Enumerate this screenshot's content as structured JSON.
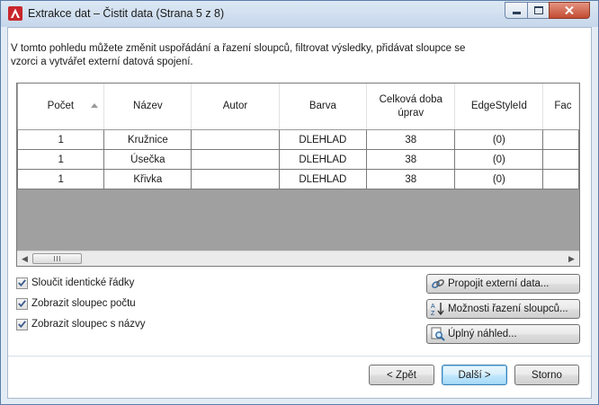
{
  "window": {
    "title": "Extrakce dat – Čistit data (Strana 5 z 8)"
  },
  "description": "V tomto pohledu můžete změnit uspořádání a řazení sloupců, filtrovat výsledky, přidávat sloupce se vzorci a vytvářet externí datová spojení.",
  "grid": {
    "columns": [
      "Počet",
      "Název",
      "Autor",
      "Barva",
      "Celková doba úprav",
      "EdgeStyleId",
      "Fac"
    ],
    "sorted_column": "Počet",
    "sort_direction": "ascending",
    "rows": [
      [
        "1",
        "Kružnice",
        "",
        "DLEHLAD",
        "38",
        "(0)",
        ""
      ],
      [
        "1",
        "Úsečka",
        "",
        "DLEHLAD",
        "38",
        "(0)",
        ""
      ],
      [
        "1",
        "Křivka",
        "",
        "DLEHLAD",
        "38",
        "(0)",
        ""
      ]
    ]
  },
  "options": {
    "combine_identical_rows": {
      "label": "Sloučit identické řádky",
      "checked": true
    },
    "show_count_column": {
      "label": "Zobrazit sloupec počtu",
      "checked": true
    },
    "show_name_column": {
      "label": "Zobrazit sloupec s názvy",
      "checked": true
    }
  },
  "side_buttons": {
    "link_external": "Propojit externí data...",
    "sort_options": "Možnosti řazení sloupců...",
    "full_preview": "Úplný náhled..."
  },
  "nav": {
    "back": "< Zpět",
    "next": "Další >",
    "cancel": "Storno"
  },
  "colors": {
    "title_bar": "#c6d7eb",
    "close_button": "#c24b32",
    "grid_empty_area": "#a0a0a0",
    "default_button": "#bee6fd"
  }
}
